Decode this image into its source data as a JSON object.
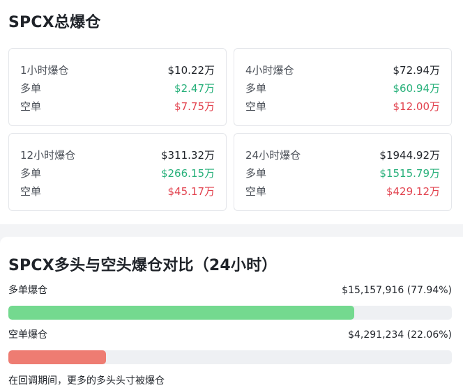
{
  "summary": {
    "title": "SPCX总爆仓",
    "cards": [
      {
        "period": "1小时爆仓",
        "total": "$10.22万",
        "long_label": "多单",
        "long": "$2.47万",
        "short_label": "空单",
        "short": "$7.75万"
      },
      {
        "period": "4小时爆仓",
        "total": "$72.94万",
        "long_label": "多单",
        "long": "$60.94万",
        "short_label": "空单",
        "short": "$12.00万"
      },
      {
        "period": "12小时爆仓",
        "total": "$311.32万",
        "long_label": "多单",
        "long": "$266.15万",
        "short_label": "空单",
        "short": "$45.17万"
      },
      {
        "period": "24小时爆仓",
        "total": "$1944.92万",
        "long_label": "多单",
        "long": "$1515.79万",
        "short_label": "空单",
        "short": "$429.12万"
      }
    ]
  },
  "comparison": {
    "title": "SPCX多头与空头爆仓对比（24小时）",
    "long": {
      "label": "多单爆仓",
      "value": "$15,157,916 (77.94%)",
      "percent": 77.94,
      "color": "#74d98f"
    },
    "short": {
      "label": "空单爆仓",
      "value": "$4,291,234 (22.06%)",
      "percent": 22.06,
      "color": "#ee7c72"
    },
    "note": "在回调期间，更多的多头头寸被爆仓"
  },
  "colors": {
    "long_text": "#27b07a",
    "short_text": "#e2434f"
  }
}
